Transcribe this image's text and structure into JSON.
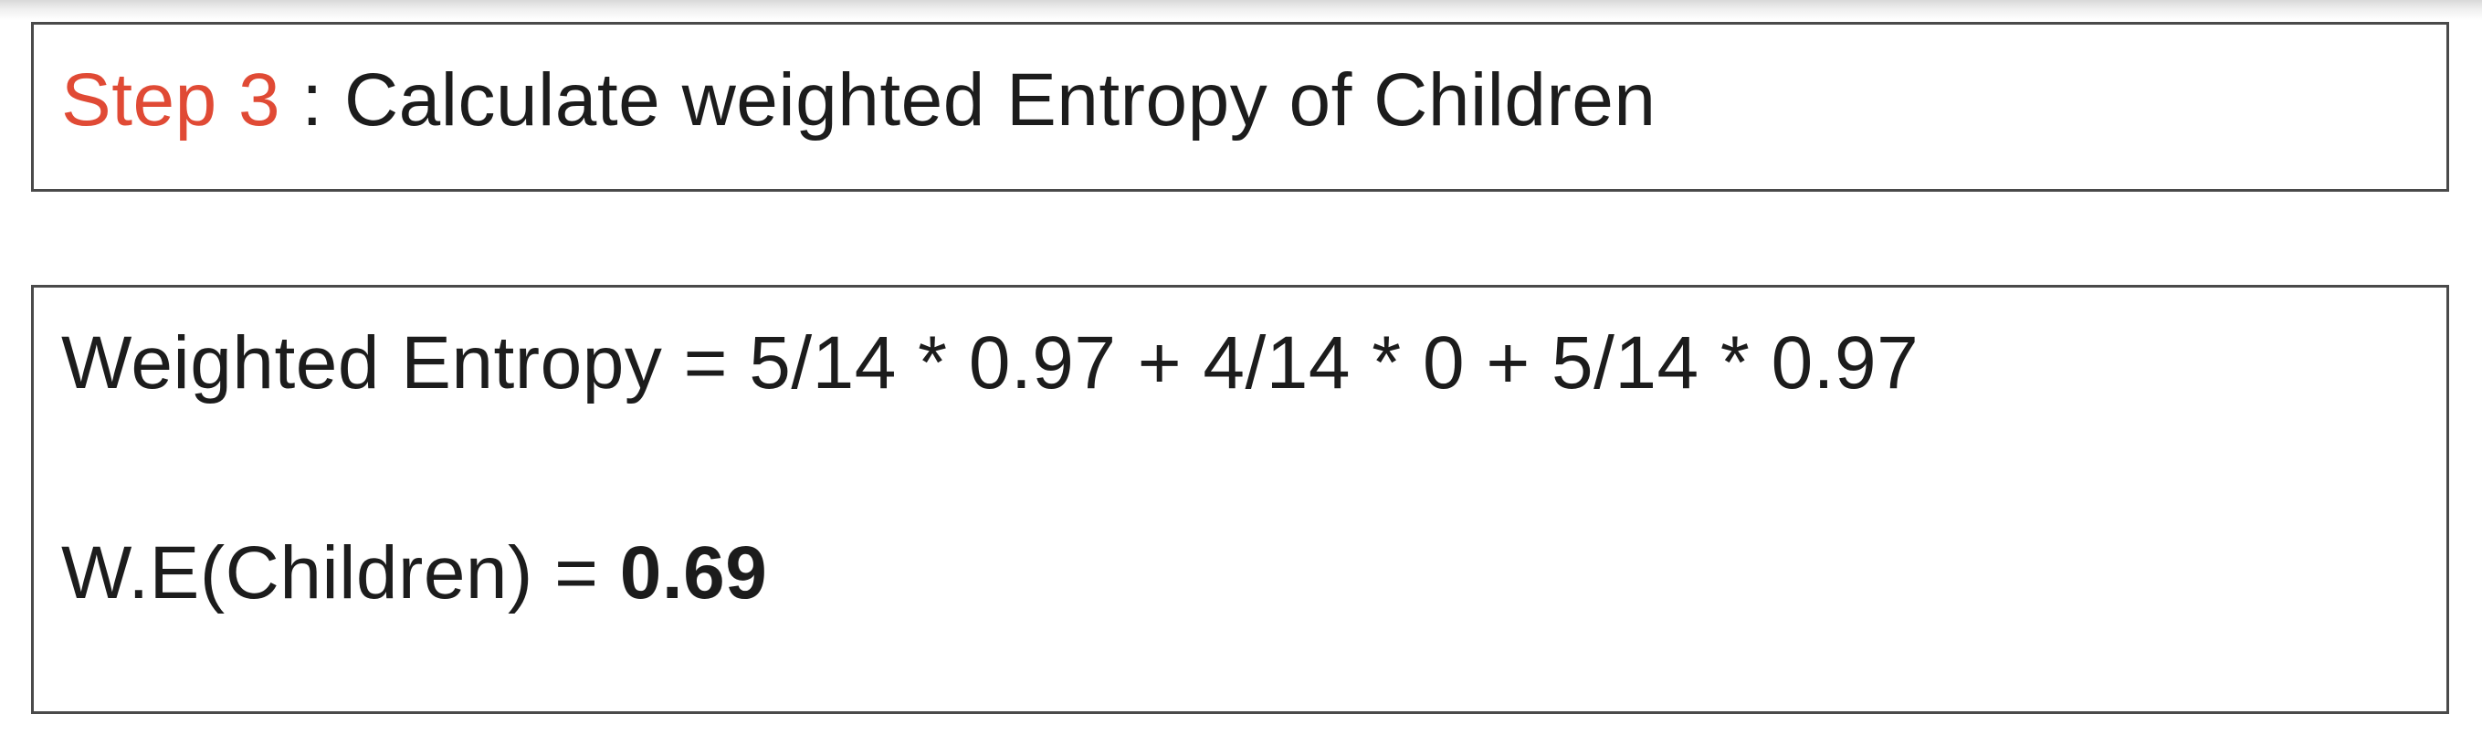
{
  "title": {
    "step_label": "Step 3",
    "separator": " : ",
    "text": "Calculate weighted Entropy of Children"
  },
  "content": {
    "formula": "Weighted Entropy = 5/14 * 0.97 + 4/14 * 0 + 5/14 * 0.97",
    "result_label": "W.E(Children) = ",
    "result_value": "0.69"
  },
  "colors": {
    "step_accent": "#e04a35",
    "text": "#1c1c1c",
    "border": "#4a4a4a"
  }
}
